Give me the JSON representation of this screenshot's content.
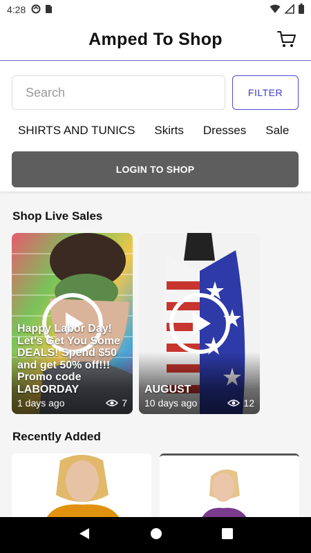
{
  "status_bar": {
    "time": "4:28",
    "left_icons": [
      "sync-icon",
      "sim-card-icon"
    ],
    "right_icons": [
      "wifi-icon",
      "cell-signal-icon",
      "battery-icon"
    ]
  },
  "header": {
    "title": "Amped To Shop",
    "cart_icon": "cart-icon"
  },
  "search": {
    "placeholder": "Search",
    "value": ""
  },
  "filter": {
    "label": "FILTER"
  },
  "categories": [
    {
      "label": "SHIRTS AND TUNICS"
    },
    {
      "label": "Skirts"
    },
    {
      "label": "Dresses"
    },
    {
      "label": "Sale"
    }
  ],
  "login": {
    "label": "LOGIN TO SHOP"
  },
  "live_section": {
    "heading": "Shop Live Sales",
    "cards": [
      {
        "title": "Happy Labor Day! Let's Get You Some DEALS! Spend $50 and get 50% off!!! Promo code LABORDAY",
        "age": "1 days ago",
        "views": "7"
      },
      {
        "title": "AUGUST",
        "age": "10 days ago",
        "views": "12"
      }
    ]
  },
  "recent_section": {
    "heading": "Recently Added"
  },
  "colors": {
    "accent": "#3a3ad0",
    "login_bg": "#5e5e5e",
    "header_border": "#6b6bd6"
  },
  "nav": {
    "back_icon": "back-triangle-icon",
    "home_icon": "home-circle-icon",
    "recents_icon": "recents-square-icon"
  }
}
